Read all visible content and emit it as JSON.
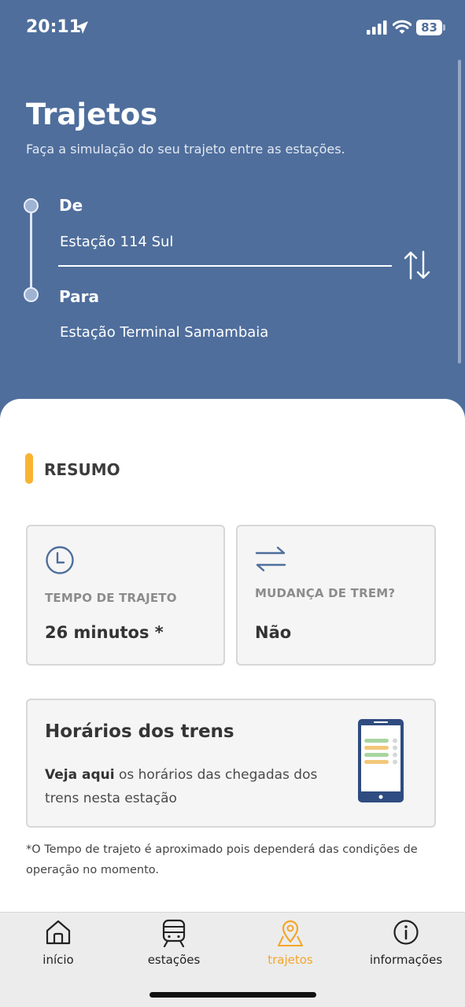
{
  "status_bar": {
    "time": "20:11",
    "battery": "83",
    "icons": [
      "location-arrow-icon",
      "signal-icon",
      "wifi-icon",
      "battery-icon"
    ]
  },
  "header": {
    "title": "Trajetos",
    "subtitle": "Faça a simulação do seu trajeto entre as estações.",
    "from_label": "De",
    "from_value": "Estação 114 Sul",
    "to_label": "Para",
    "to_value": "Estação Terminal Samambaia",
    "swap_icon": "swap-vertical-arrows-icon"
  },
  "summary": {
    "title": "RESUMO",
    "time_card": {
      "icon": "clock-icon",
      "label": "TEMPO DE TRAJETO",
      "value": "26 minutos *"
    },
    "change_card": {
      "icon": "swap-horizontal-arrows-icon",
      "label": "MUDANÇA DE TREM?",
      "value": "Não"
    }
  },
  "schedule_card": {
    "title": "Horários dos trens",
    "link_text": "Veja aqui",
    "text_rest": " os horários das chegadas dos trens nesta estação",
    "icon": "phone-schedule-icon"
  },
  "footnote": "*O Tempo de trajeto é aproximado pois dependerá das condições de operação no momento.",
  "bottom_nav": {
    "items": [
      {
        "label": "início",
        "icon": "home-icon",
        "active": false
      },
      {
        "label": "estações",
        "icon": "train-icon",
        "active": false
      },
      {
        "label": "trajetos",
        "icon": "map-pin-icon",
        "active": true
      },
      {
        "label": "informações",
        "icon": "info-icon",
        "active": false
      }
    ]
  },
  "colors": {
    "header_bg": "#4f6e9c",
    "accent": "#f8b431",
    "active_nav": "#f4a62a",
    "card_bg": "#f5f5f5"
  }
}
